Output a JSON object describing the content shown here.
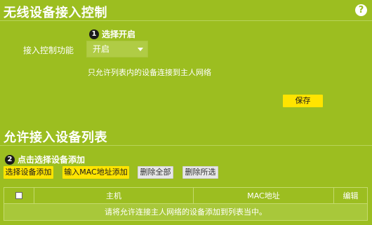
{
  "section1": {
    "title": "无线设备接入控制",
    "help_icon": "?",
    "step1": {
      "number": "1",
      "label": "选择开启"
    },
    "field_label": "接入控制功能",
    "select": {
      "value": "开启"
    },
    "hint": "只允许列表内的设备连接到主人网络",
    "save_label": "保存"
  },
  "section2": {
    "title": "允许接入设备列表",
    "step2": {
      "number": "2",
      "label": "点击选择设备添加"
    },
    "buttons": [
      {
        "label": "选择设备添加",
        "style": "yellow"
      },
      {
        "label": "输入MAC地址添加",
        "style": "yellow"
      },
      {
        "label": "删除全部",
        "style": "grey"
      },
      {
        "label": "删除所选",
        "style": "grey"
      }
    ],
    "table": {
      "headers": [
        "主机",
        "MAC地址",
        "编辑"
      ],
      "empty_message": "请将允许连接主人网络的设备添加到列表当中。"
    }
  },
  "colors": {
    "background": "#9cbe20",
    "accent_button": "#ffe400"
  }
}
